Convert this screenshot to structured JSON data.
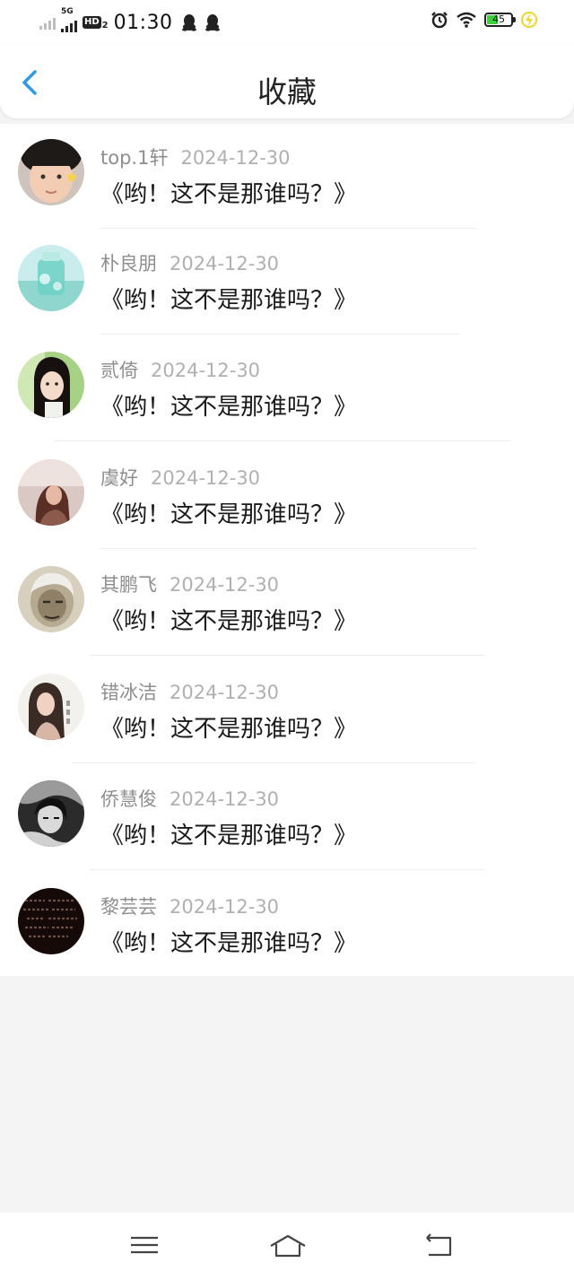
{
  "status_bar": {
    "network": "5G",
    "hd_label": "HD",
    "hd_sub": "2",
    "time": "01:30",
    "battery_level": "45",
    "icons": [
      "qq-icon",
      "qq-icon",
      "alarm-icon",
      "wifi-icon",
      "battery-icon",
      "charging-icon"
    ]
  },
  "header": {
    "title": "收藏",
    "back_icon": "chevron-left-icon"
  },
  "favorites": [
    {
      "name": "top.1轩",
      "date": "2024-12-30",
      "content": "《哟！这不是那谁吗？》",
      "avatar": "avatar-boy-face"
    },
    {
      "name": "朴良朋",
      "date": "2024-12-30",
      "content": "《哟！这不是那谁吗？》",
      "avatar": "avatar-cyan-bottle"
    },
    {
      "name": "贰倚",
      "date": "2024-12-30",
      "content": "《哟！这不是那谁吗？》",
      "avatar": "avatar-girl-green"
    },
    {
      "name": "虞好",
      "date": "2024-12-30",
      "content": "《哟！这不是那谁吗？》",
      "avatar": "avatar-girl-warm"
    },
    {
      "name": "其鹏飞",
      "date": "2024-12-30",
      "content": "《哟！这不是那谁吗？》",
      "avatar": "avatar-sketch-old-man"
    },
    {
      "name": "错冰洁",
      "date": "2024-12-30",
      "content": "《哟！这不是那谁吗？》",
      "avatar": "avatar-girl-white"
    },
    {
      "name": "侨慧俊",
      "date": "2024-12-30",
      "content": "《哟！这不是那谁吗？》",
      "avatar": "avatar-dark-sketch"
    },
    {
      "name": "黎芸芸",
      "date": "2024-12-30",
      "content": "《哟！这不是那谁吗？》",
      "avatar": "avatar-black-text"
    }
  ],
  "nav_bar": {
    "icons": [
      "menu-icon",
      "home-icon",
      "back-icon"
    ]
  },
  "colors": {
    "accent": "#2e9ae8",
    "name_text": "#8e8e8e",
    "date_text": "#b0b0b0",
    "content_text": "#1a1a1a",
    "background": "#f5f4f5"
  }
}
